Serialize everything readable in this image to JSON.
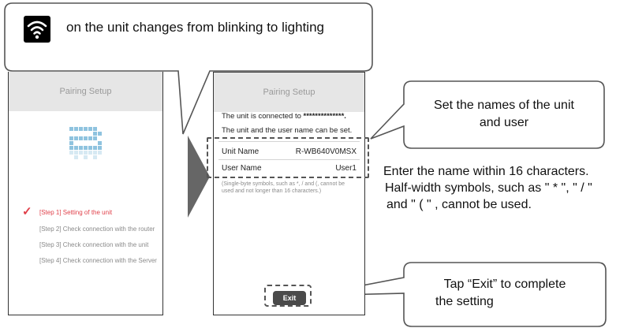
{
  "top_callout": {
    "text": "on the unit changes from blinking to lighting",
    "icon": "wifi-icon"
  },
  "left_screen": {
    "header": "Pairing Setup",
    "progress_icon": "progress-grid-icon",
    "steps": [
      {
        "label": "[Step 1] Setting of the unit",
        "active": true
      },
      {
        "label": "[Step 2] Check connection with the router",
        "active": false
      },
      {
        "label": "[Step 3] Check connection with the unit",
        "active": false
      },
      {
        "label": "[Step 4] Check connection with the Server",
        "active": false
      }
    ],
    "checkmark": "✓"
  },
  "right_screen": {
    "header": "Pairing Setup",
    "connected_prefix": "The unit is connected to ",
    "connected_ssid": "**************.",
    "names_info": "The unit and the user name can be set.",
    "unit_name_label": "Unit Name",
    "unit_name_value": "R-WB640V0MSX",
    "user_name_label": "User Name",
    "user_name_value": "User1",
    "note_line1": "(Single-byte symbols, such as *, / and (, cannot be",
    "note_line2": "used and not longer than 16 characters.)",
    "exit_label": "Exit"
  },
  "names_callout": {
    "line1": "Set the names of the unit",
    "line2": "and user"
  },
  "names_note": {
    "line1": "Enter the name within 16 characters.",
    "line2": "Half-width symbols, such as \" * \", \" / \"",
    "line3": "and \" ( \" , cannot be used."
  },
  "exit_callout": {
    "line1": "Tap “Exit” to complete",
    "line2": "the setting"
  },
  "colors": {
    "accent_red": "#e0404a",
    "progress_blue": "#8fc3df",
    "arrow_gray": "#666666"
  }
}
